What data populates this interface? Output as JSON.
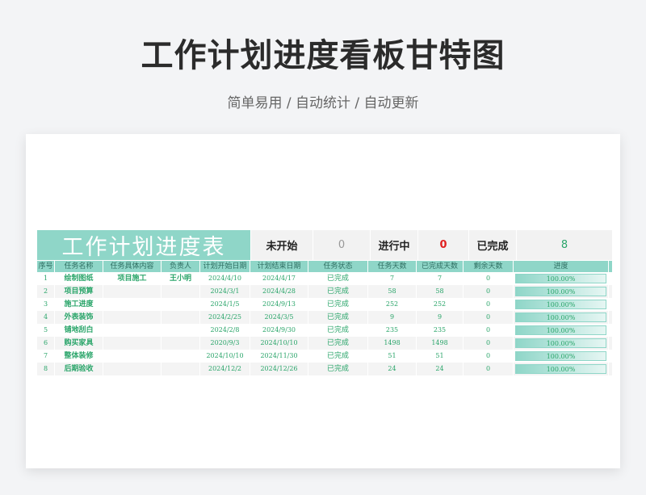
{
  "page": {
    "title": "工作计划进度看板甘特图",
    "subtitle": "简单易用 / 自动统计 / 自动更新"
  },
  "sheet": {
    "title": "工作计划进度表",
    "stats": [
      {
        "label": "未开始",
        "value": "0",
        "color": "#999999"
      },
      {
        "label": "进行中",
        "value": "0",
        "color": "#e02020"
      },
      {
        "label": "已完成",
        "value": "8",
        "color": "#2aa56a"
      }
    ],
    "columns": [
      "序号",
      "任务名称",
      "任务具体内容",
      "负责人",
      "计划开始日期",
      "计划结束日期",
      "任务状态",
      "任务天数",
      "已完成天数",
      "剩余天数",
      "进度"
    ],
    "rows": [
      {
        "no": "1",
        "name": "绘制图纸",
        "content": "项目施工",
        "owner": "王小明",
        "start": "2024/4/10",
        "end": "2024/4/17",
        "status": "已完成",
        "days": "7",
        "done": "7",
        "remain": "0",
        "progress": "100.00%",
        "progress_value": 1.0
      },
      {
        "no": "2",
        "name": "项目预算",
        "content": "",
        "owner": "",
        "start": "2024/3/1",
        "end": "2024/4/28",
        "status": "已完成",
        "days": "58",
        "done": "58",
        "remain": "0",
        "progress": "100.00%",
        "progress_value": 1.0
      },
      {
        "no": "3",
        "name": "施工进度",
        "content": "",
        "owner": "",
        "start": "2024/1/5",
        "end": "2024/9/13",
        "status": "已完成",
        "days": "252",
        "done": "252",
        "remain": "0",
        "progress": "100.00%",
        "progress_value": 1.0
      },
      {
        "no": "4",
        "name": "外表装饰",
        "content": "",
        "owner": "",
        "start": "2024/2/25",
        "end": "2024/3/5",
        "status": "已完成",
        "days": "9",
        "done": "9",
        "remain": "0",
        "progress": "100.00%",
        "progress_value": 1.0
      },
      {
        "no": "5",
        "name": "铺地刮白",
        "content": "",
        "owner": "",
        "start": "2024/2/8",
        "end": "2024/9/30",
        "status": "已完成",
        "days": "235",
        "done": "235",
        "remain": "0",
        "progress": "100.00%",
        "progress_value": 1.0
      },
      {
        "no": "6",
        "name": "购买家具",
        "content": "",
        "owner": "",
        "start": "2020/9/3",
        "end": "2024/10/10",
        "status": "已完成",
        "days": "1498",
        "done": "1498",
        "remain": "0",
        "progress": "100.00%",
        "progress_value": 1.0
      },
      {
        "no": "7",
        "name": "整体装修",
        "content": "",
        "owner": "",
        "start": "2024/10/10",
        "end": "2024/11/30",
        "status": "已完成",
        "days": "51",
        "done": "51",
        "remain": "0",
        "progress": "100.00%",
        "progress_value": 1.0
      },
      {
        "no": "8",
        "name": "后期验收",
        "content": "",
        "owner": "",
        "start": "2024/12/2",
        "end": "2024/12/26",
        "status": "已完成",
        "days": "24",
        "done": "24",
        "remain": "0",
        "progress": "100.00%",
        "progress_value": 1.0
      }
    ]
  }
}
